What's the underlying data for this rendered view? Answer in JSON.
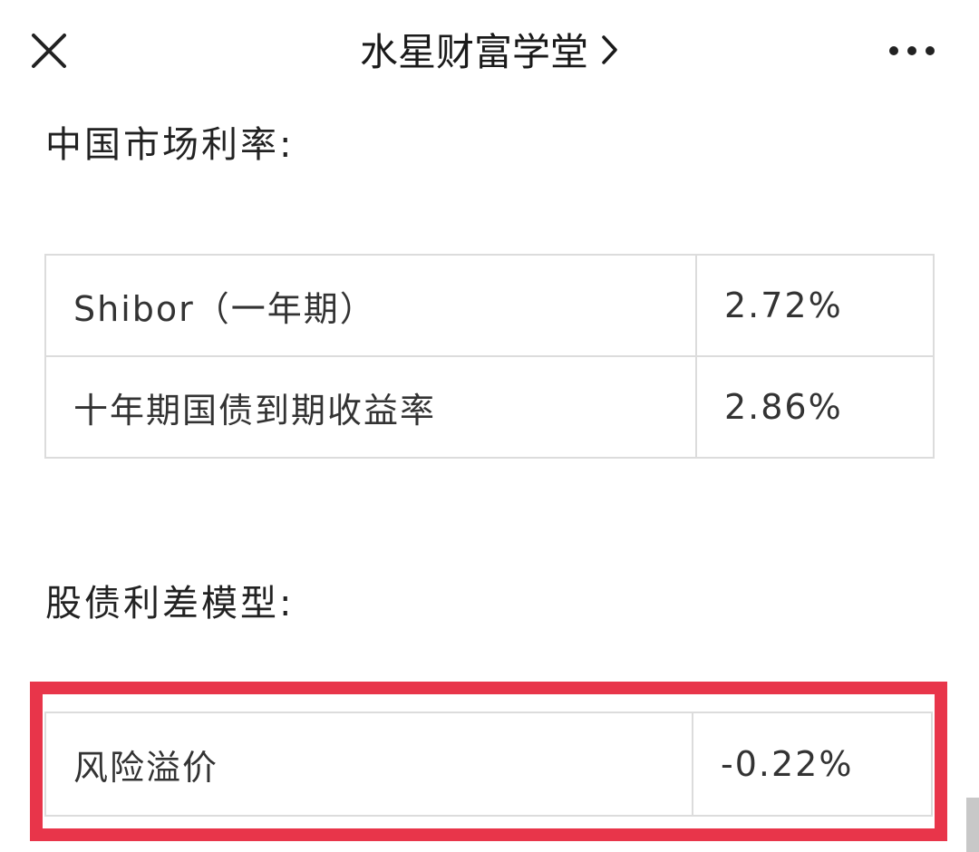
{
  "header": {
    "title": "水星财富学堂",
    "close_icon": "close-icon",
    "title_chevron_icon": "chevron-right-icon",
    "more_icon": "more-horizontal-icon"
  },
  "section_market": {
    "heading": "中国市场利率:",
    "rows": [
      {
        "label": "Shibor（一年期）",
        "value": "2.72%"
      },
      {
        "label": "十年期国债到期收益率",
        "value": "2.86%"
      }
    ]
  },
  "section_model": {
    "heading": "股债利差模型:",
    "rows": [
      {
        "label": "风险溢价",
        "value": "-0.22%"
      }
    ]
  },
  "colors": {
    "highlight_border": "#e8354a",
    "table_border": "#dcdcdc"
  }
}
